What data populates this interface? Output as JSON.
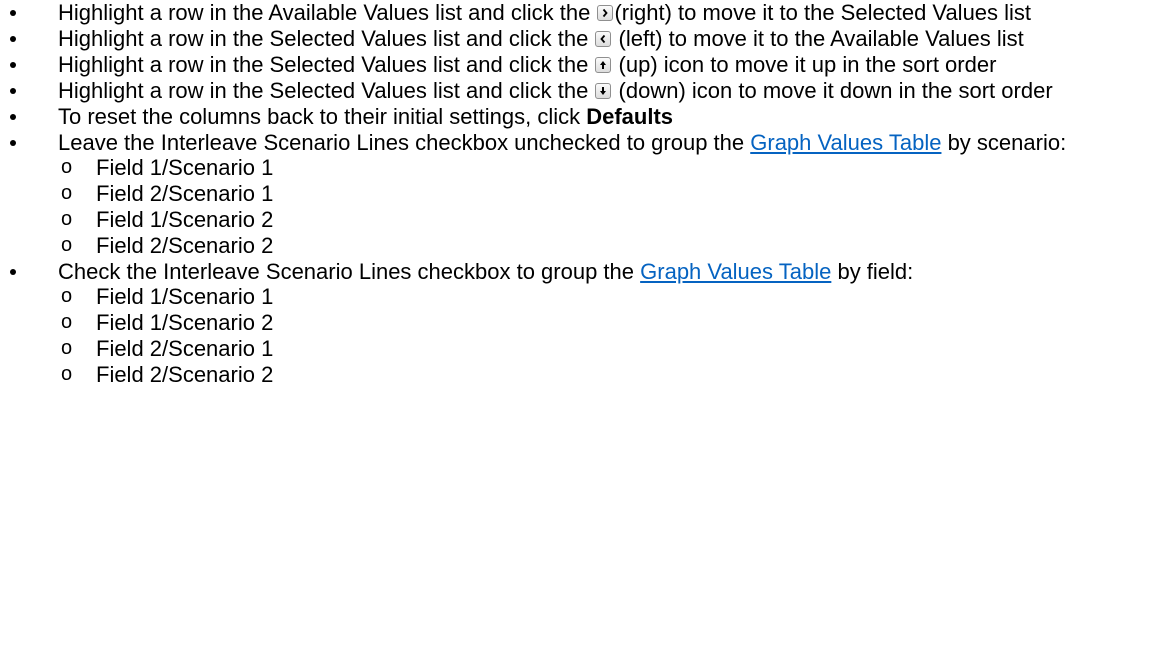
{
  "bullets": {
    "b1": {
      "pre": "Highlight a row in the Available Values list and click the ",
      "post": "(right) to move it to the Selected Values list",
      "icon": "chevron-right-icon"
    },
    "b2": {
      "pre": "Highlight a row in the Selected Values list and click the ",
      "post": " (left) to move it to the Available Values list",
      "icon": "chevron-left-icon"
    },
    "b3": {
      "pre": "Highlight a row in the Selected Values list and click the  ",
      "post": " (up) icon to move it up in the sort order",
      "icon": "arrow-up-icon"
    },
    "b4": {
      "pre": "Highlight a row in the Selected Values list and click the ",
      "post": " (down) icon to move it down in the sort order",
      "icon": "arrow-down-icon"
    },
    "b5": {
      "pre": "To reset the columns back to their initial settings, click ",
      "bold": "Defaults"
    },
    "b6": {
      "pre": "Leave the Interleave Scenario Lines checkbox unchecked to group the ",
      "link": "Graph Values Table",
      "post": " by scenario:",
      "sub": [
        "Field 1/Scenario 1",
        "Field 2/Scenario 1",
        "Field 1/Scenario 2",
        "Field 2/Scenario 2"
      ]
    },
    "b7": {
      "pre": "Check the Interleave Scenario Lines checkbox to group the ",
      "link": "Graph Values Table",
      "post": " by field:",
      "sub": [
        "Field 1/Scenario 1",
        "Field 1/Scenario 2",
        "Field 2/Scenario 1",
        "Field 2/Scenario 2"
      ]
    }
  }
}
